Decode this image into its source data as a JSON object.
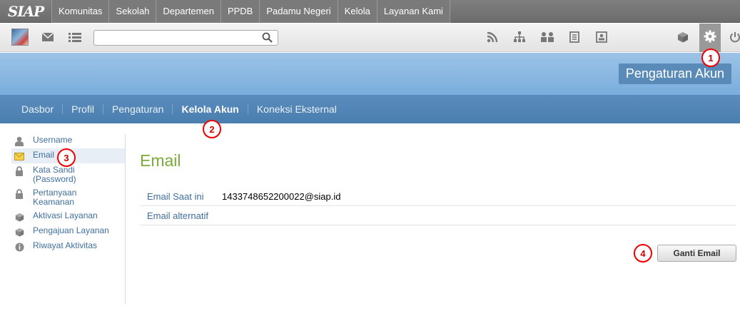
{
  "brand": {
    "logo": "SIAP"
  },
  "topnav": {
    "items": [
      "Komunitas",
      "Sekolah",
      "Departemen",
      "PPDB",
      "Padamu Negeri",
      "Kelola",
      "Layanan Kami"
    ]
  },
  "toolbar": {
    "search_value": "",
    "icons": [
      "mail-icon",
      "list-icon",
      "rss-icon",
      "hierarchy-icon",
      "group-icon",
      "document-icon",
      "contact-card-icon",
      "cube-icon",
      "gear-icon",
      "power-icon"
    ]
  },
  "header": {
    "title": "Pengaturan Akun"
  },
  "subnav": {
    "items": [
      {
        "label": "Dasbor",
        "active": false
      },
      {
        "label": "Profil",
        "active": false
      },
      {
        "label": "Pengaturan",
        "active": false
      },
      {
        "label": "Kelola Akun",
        "active": true
      },
      {
        "label": "Koneksi Eksternal",
        "active": false
      }
    ]
  },
  "sidebar": {
    "items": [
      {
        "label": "Username",
        "icon": "user-icon"
      },
      {
        "label": "Email",
        "icon": "envelope-icon",
        "active": true
      },
      {
        "label": "Kata Sandi (Password)",
        "icon": "lock-icon"
      },
      {
        "label": "Pertanyaan Keamanan",
        "icon": "lock-icon"
      },
      {
        "label": "Aktivasi Layanan",
        "icon": "box-icon"
      },
      {
        "label": "Pengajuan Layanan",
        "icon": "box-icon"
      },
      {
        "label": "Riwayat Aktivitas",
        "icon": "info-icon"
      }
    ]
  },
  "main": {
    "title": "Email",
    "rows": [
      {
        "label": "Email Saat ini",
        "value": "1433748652200022@siap.id"
      },
      {
        "label": "Email alternatif",
        "value": ""
      }
    ],
    "button_label": "Ganti Email"
  },
  "annotations": [
    "1",
    "2",
    "3",
    "4"
  ],
  "colors": {
    "accent_blue": "#5a8dbd",
    "title_green": "#7aac3a",
    "marker_red": "#e00000"
  }
}
